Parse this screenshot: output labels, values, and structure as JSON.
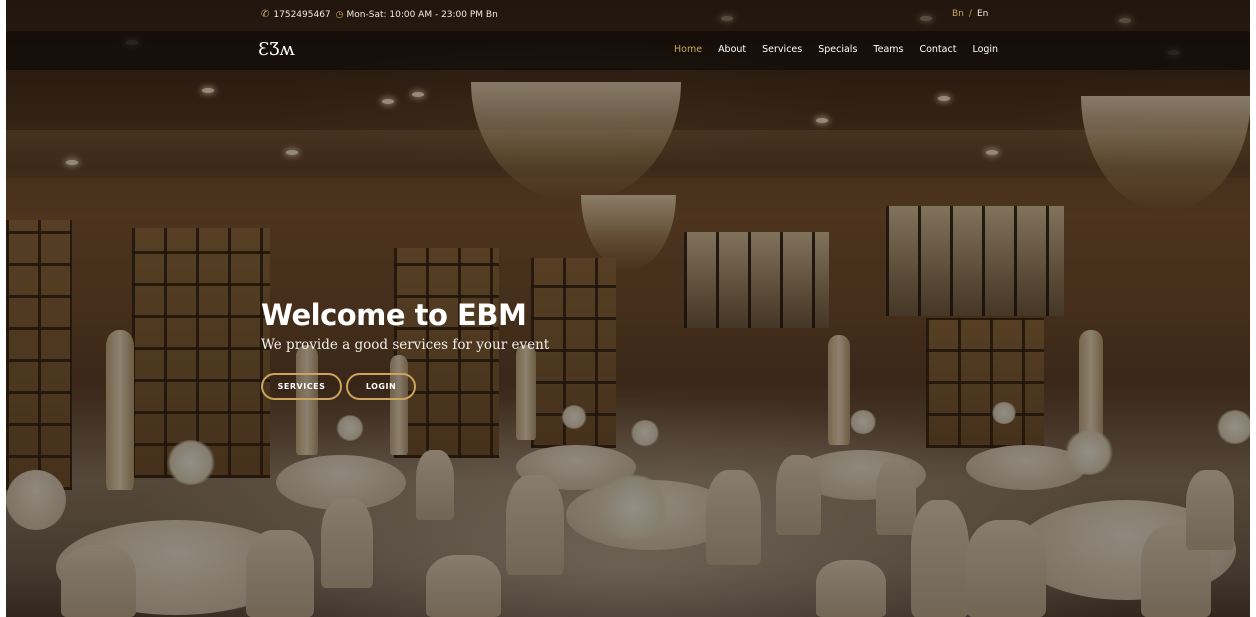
{
  "topbar": {
    "phone": "1752495467",
    "hours": "Mon-Sat: 10:00 AM - 23:00 PM Bn",
    "phone_icon": "phone-icon",
    "clock_icon": "clock-icon",
    "languages": {
      "active": "Bn",
      "separator": "/",
      "other": "En"
    }
  },
  "navbar": {
    "logo": "ƐƷʍ",
    "items": [
      {
        "label": "Home",
        "active": true
      },
      {
        "label": "About",
        "active": false
      },
      {
        "label": "Services",
        "active": false
      },
      {
        "label": "Specials",
        "active": false
      },
      {
        "label": "Teams",
        "active": false
      },
      {
        "label": "Contact",
        "active": false
      },
      {
        "label": "Login",
        "active": false
      }
    ]
  },
  "hero": {
    "title": "Welcome to EBM",
    "subtitle": "We provide a good services for your event",
    "buttons": {
      "services": "SERVICES",
      "login": "LOGIN"
    }
  },
  "colors": {
    "accent": "#cda45e",
    "navbar_bg": "#120d08",
    "text": "#ffffff"
  }
}
